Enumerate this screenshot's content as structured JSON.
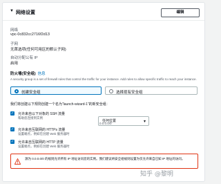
{
  "section": {
    "caret": "▼",
    "title": "网络设置",
    "edit_label": "编辑"
  },
  "fields": {
    "network_label": "网络",
    "network_value": "vpc-0c832cc2716f2d13",
    "subnet_label": "子网",
    "subnet_value": "无首选项(任何可用区的默认子网)",
    "public_ip_label": "自动分配公有 IP",
    "public_ip_value": "启用"
  },
  "firewall": {
    "label": "防火墙(安全组)",
    "info_link": "信息",
    "description": "A security group is a set of firewall rules that control the traffic for your instance. Add rules to allow specific traffic to reach your instance.",
    "option_create": "创建安全组",
    "option_existing": "选择现有安全组",
    "create_text": "我们将创建以下规则创建一个名为“launch-wizard-1”的新安全组："
  },
  "rules": [
    {
      "title": "允许来自以下对象的 SSH 流量",
      "help": "帮助您连接到实例",
      "checked": true
    },
    {
      "title": "允许来自互联网的 HTTPs 流量",
      "help": "设置端点，例如在创建 Web 服务器时",
      "checked": true
    },
    {
      "title": "允许来自互联网的 HTTP 流量",
      "help": "设置端点，例如在创建 Web 服务器时",
      "checked": true
    }
  ],
  "source_select": {
    "value": "任何位置",
    "sub": "0.0.0.0/0"
  },
  "warning": {
    "text": "源为 0.0.0.0/0 的规则允许所有 IP 地址访问您的实例。我们建议将安全组规则设置为仅允许来自已知 IP 地址的访问。"
  },
  "watermark": "知乎 @黎明",
  "colors": {
    "accent": "#0073bb",
    "warning": "#df3312"
  }
}
